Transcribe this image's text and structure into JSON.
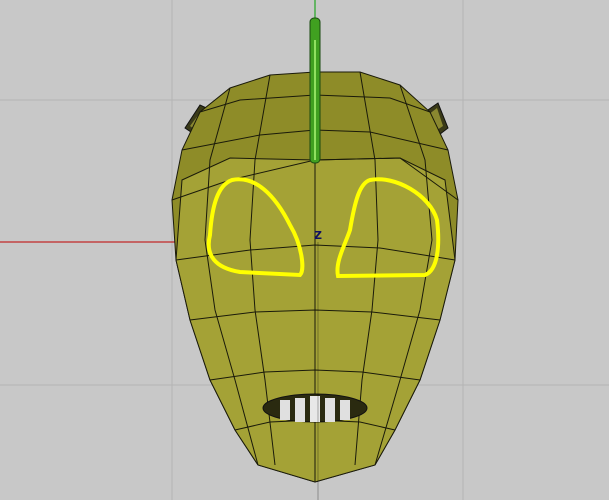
{
  "viewport": {
    "axis_label": "Z",
    "colors": {
      "background": "#c8c8c8",
      "grid": "#b0b0b0",
      "x_axis": "#c00000",
      "z_axis": "#00a000",
      "mesh_light": "#a8a638",
      "mesh_dark": "#7c7a1e",
      "edges": "#1a1a0a",
      "eye_outline": "#ffff00"
    }
  }
}
